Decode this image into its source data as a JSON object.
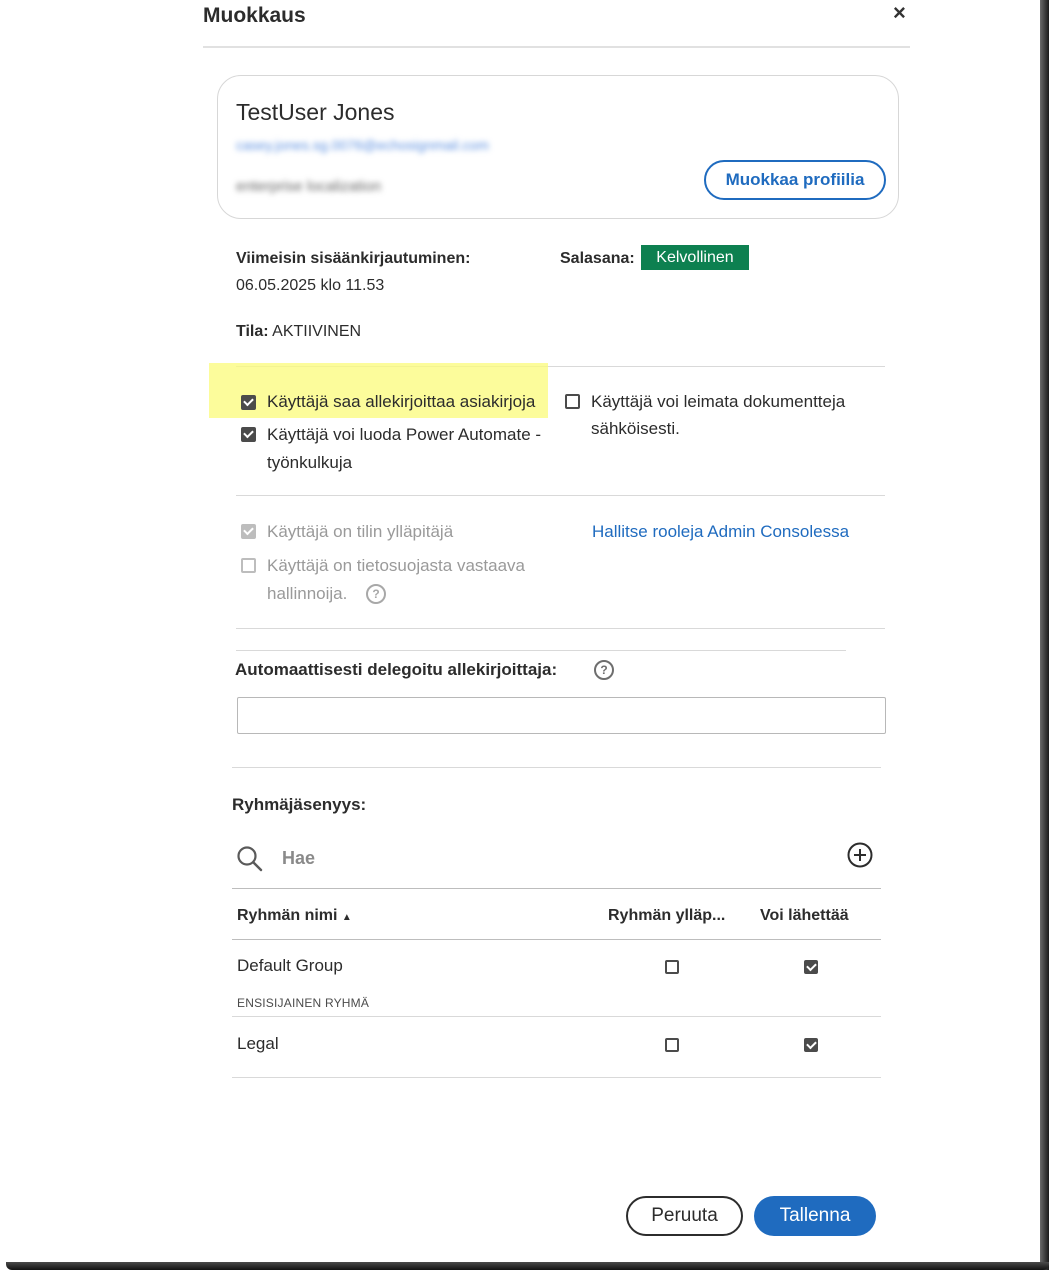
{
  "dialog": {
    "title": "Muokkaus",
    "close_label": "×"
  },
  "profile": {
    "name": "TestUser Jones",
    "email": "casey.jones.sg.0076@echosignmail.com",
    "organization": "enterprise localization",
    "edit_button": "Muokkaa profiilia"
  },
  "info": {
    "last_login_label": "Viimeisin sisäänkirjautuminen:",
    "last_login_value": "06.05.2025 klo 11.53",
    "password_label": "Salasana:",
    "password_badge": "Kelvollinen",
    "status_label": "Tila:",
    "status_value": "AKTIIVINEN"
  },
  "permissions": {
    "can_sign_label": "Käyttäjä saa allekirjoittaa asiakirjoja",
    "can_sign_checked": true,
    "can_power_automate_label_1": "Käyttäjä voi luoda Power Automate -",
    "can_power_automate_label_2": "työnkulkuja",
    "can_power_automate_checked": true,
    "can_seal_label_1": "Käyttäjä voi leimata dokumentteja",
    "can_seal_label_2": "sähköisesti.",
    "can_seal_checked": false
  },
  "roles": {
    "account_admin_label": "Käyttäjä on tilin ylläpitäjä",
    "account_admin_checked": true,
    "privacy_admin_label_1": "Käyttäjä on tietosuojasta vastaava",
    "privacy_admin_label_2": "hallinnoija.",
    "privacy_admin_checked": false,
    "manage_roles_link": "Hallitse rooleja Admin Consolessa"
  },
  "delegate": {
    "label": "Automaattisesti delegoitu allekirjoittaja:",
    "value": ""
  },
  "groups": {
    "title": "Ryhmäjäsenyys:",
    "search_placeholder": "Hae",
    "columns": [
      "Ryhmän nimi",
      "Ryhmän ylläp...",
      "Voi lähettää"
    ],
    "rows": [
      {
        "name": "Default Group",
        "sub": "ENSISIJAINEN RYHMÄ",
        "group_admin": false,
        "can_send": true
      },
      {
        "name": "Legal",
        "sub": "",
        "group_admin": false,
        "can_send": true
      }
    ]
  },
  "footer": {
    "cancel": "Peruuta",
    "save": "Tallenna"
  },
  "colors": {
    "accent": "#1f6bbf",
    "badge_green": "#0d8050",
    "highlight": "#fbfb7a"
  }
}
